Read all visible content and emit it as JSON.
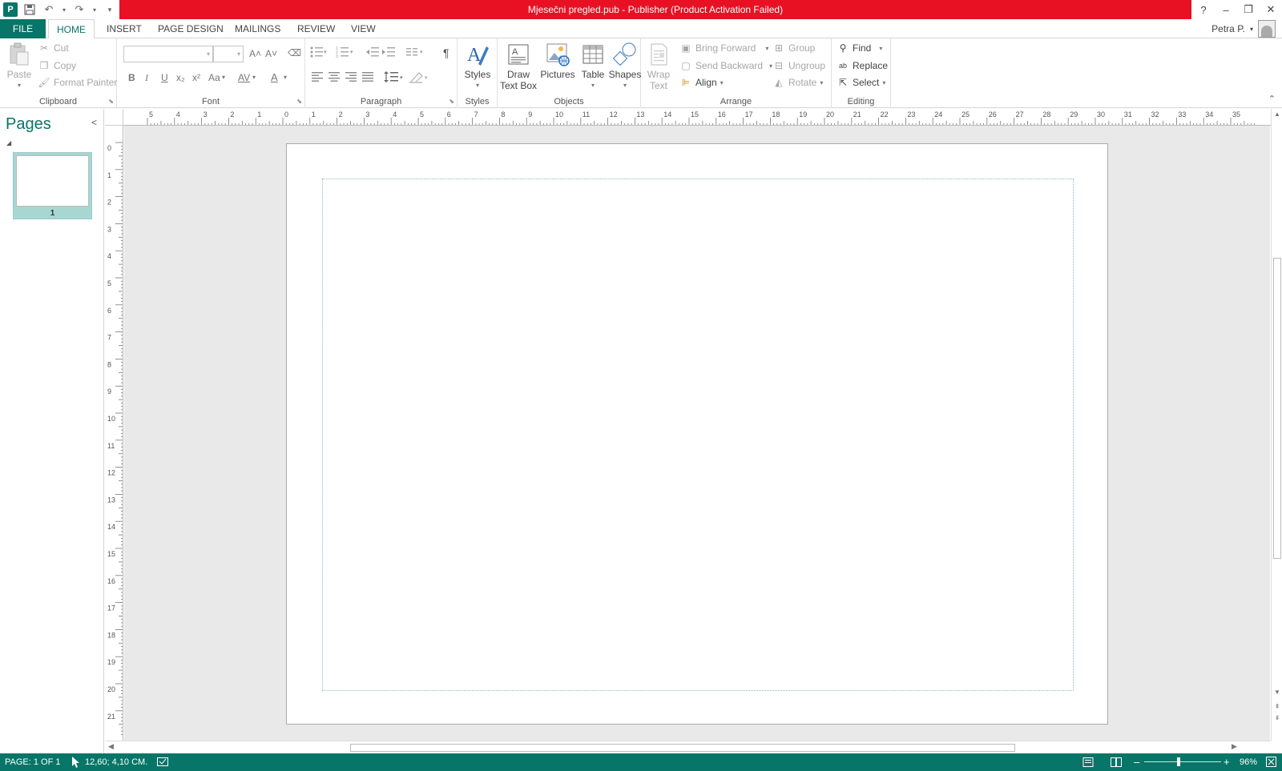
{
  "window": {
    "title": "Mjesečni pregled.pub -  Publisher (Product Activation Failed)",
    "help": "?",
    "minimize": "–",
    "restore": "❐",
    "close": "✕"
  },
  "qat": {
    "app_icon": "P",
    "save_icon": "💾",
    "undo_icon": "↶",
    "redo_icon": "↷",
    "customize_icon": "▾"
  },
  "tabs": [
    "FILE",
    "HOME",
    "INSERT",
    "PAGE DESIGN",
    "MAILINGS",
    "REVIEW",
    "VIEW"
  ],
  "user": {
    "name": "Petra P.",
    "caret": "▾"
  },
  "ribbon": {
    "clipboard": {
      "label": "Clipboard",
      "paste": "Paste",
      "cut": "Cut",
      "copy": "Copy",
      "format_painter": "Format Painter"
    },
    "font": {
      "label": "Font",
      "bold": "B",
      "italic": "I",
      "underline": "U",
      "subscript": "x₂",
      "superscript": "x²",
      "change_case": "Aa",
      "char_spacing": "AV",
      "font_color": "A",
      "grow": "A˄",
      "shrink": "A˅",
      "clear": "⌫"
    },
    "paragraph": {
      "label": "Paragraph",
      "show_marks": "¶"
    },
    "styles": {
      "label": "Styles",
      "button": "Styles"
    },
    "objects": {
      "label": "Objects",
      "draw_text_box_1": "Draw",
      "draw_text_box_2": "Text Box",
      "pictures": "Pictures",
      "table": "Table",
      "shapes": "Shapes"
    },
    "arrange": {
      "label": "Arrange",
      "wrap_text_1": "Wrap",
      "wrap_text_2": "Text",
      "bring_forward": "Bring Forward",
      "send_backward": "Send Backward",
      "align": "Align",
      "group": "Group",
      "ungroup": "Ungroup",
      "rotate": "Rotate"
    },
    "editing": {
      "label": "Editing",
      "find": "Find",
      "replace": "Replace",
      "select": "Select"
    }
  },
  "pages_pane": {
    "title": "Pages",
    "collapse": "<",
    "thumbnails": [
      {
        "number": "1"
      }
    ]
  },
  "ruler": {
    "h_labels": [
      "5",
      "4",
      "3",
      "2",
      "1",
      "0",
      "1",
      "2",
      "3",
      "4",
      "5",
      "6",
      "7",
      "8",
      "9",
      "10",
      "11",
      "12",
      "13",
      "14",
      "15",
      "16",
      "17",
      "18",
      "19",
      "20",
      "21",
      "22",
      "23",
      "24",
      "25",
      "26",
      "27",
      "28",
      "29",
      "30",
      "31",
      "32",
      "33",
      "34",
      "35"
    ],
    "v_labels": [
      "0",
      "1",
      "2",
      "3",
      "4",
      "5",
      "6",
      "7",
      "8",
      "9",
      "10",
      "11",
      "12",
      "13",
      "14",
      "15",
      "16",
      "17",
      "18",
      "19",
      "20",
      "21"
    ]
  },
  "status": {
    "page": "PAGE: 1 OF 1",
    "position": "12,60; 4,10 CM.",
    "zoom": "96%",
    "zoom_minus": "–",
    "zoom_plus": "+"
  },
  "colors": {
    "accent": "#077568",
    "titlebar_alert": "#e81123"
  }
}
